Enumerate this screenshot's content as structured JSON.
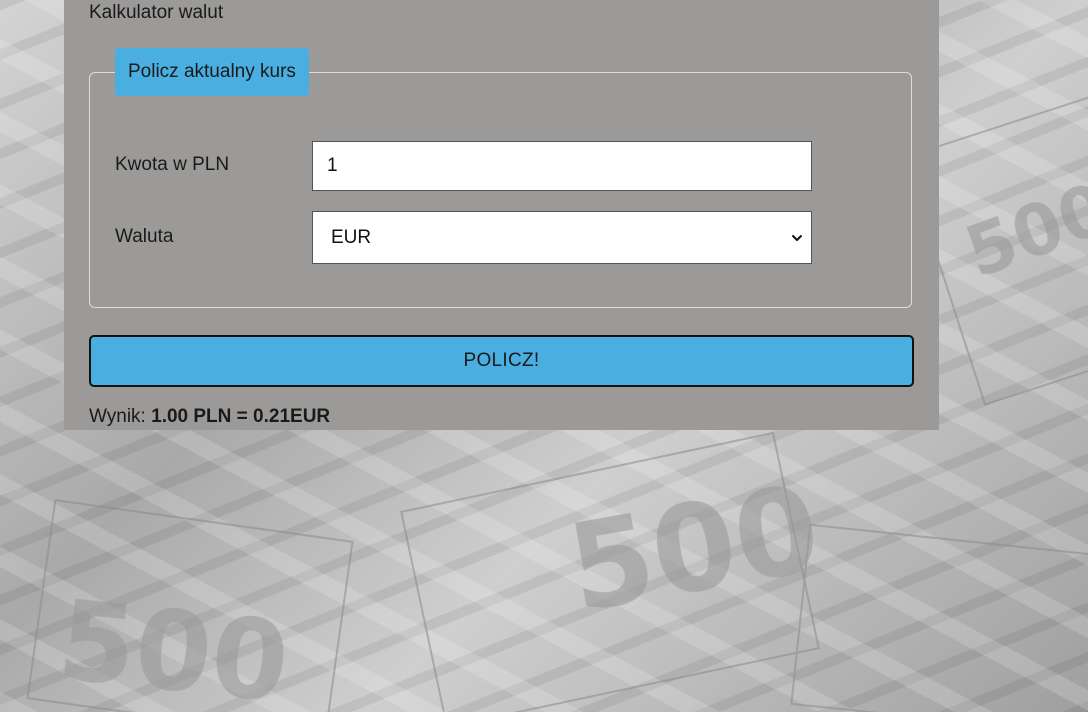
{
  "app": {
    "title": "Kalkulator walut"
  },
  "form": {
    "legend": "Policz aktualny kurs",
    "amount_label": "Kwota w PLN",
    "amount_value": "1",
    "currency_label": "Waluta",
    "currency_selected": "EUR",
    "submit_label": "POLICZ!"
  },
  "result": {
    "label": "Wynik:",
    "value": "1.00 PLN = 0.21EUR"
  },
  "icons": {
    "select_arrow": "chevron-down-icon",
    "background": "euro-banknotes-image"
  },
  "colors": {
    "accent": "#4aaee0",
    "panel": "#9c9a98",
    "text": "#1a1a1a"
  }
}
